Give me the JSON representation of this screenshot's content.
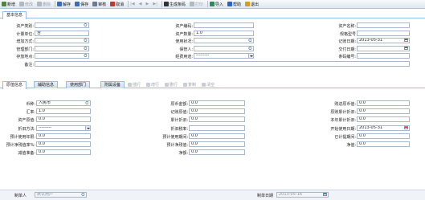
{
  "toolbar": {
    "buttons": [
      {
        "label": "新增",
        "enabled": true,
        "icon": "new-icon",
        "color": "#4b8a3b"
      },
      {
        "label": "修改",
        "enabled": false,
        "icon": "edit-icon",
        "color": "#b0b8c2"
      },
      {
        "label": "删除",
        "enabled": false,
        "icon": "delete-icon",
        "color": "#b0b8c2"
      },
      {
        "label": "解存",
        "enabled": true,
        "icon": "unsave-icon",
        "color": "#3a6db5"
      },
      {
        "label": "保存",
        "enabled": true,
        "icon": "save-icon",
        "color": "#3a6db5"
      },
      {
        "label": "审核",
        "enabled": true,
        "icon": "audit-icon",
        "color": "#6a7d94"
      },
      {
        "label": "取消",
        "enabled": true,
        "icon": "cancel-icon",
        "color": "#c0392b"
      },
      {
        "label": "生成条码",
        "enabled": true,
        "icon": "barcode-icon",
        "color": "#333333"
      },
      {
        "label": "打印",
        "enabled": false,
        "icon": "print-icon",
        "color": "#b0b8c2"
      },
      {
        "label": "导入",
        "enabled": true,
        "icon": "import-icon",
        "color": "#2e8b57"
      },
      {
        "label": "帮助",
        "enabled": true,
        "icon": "help-icon",
        "color": "#2a62c9"
      },
      {
        "label": "退出",
        "enabled": true,
        "icon": "exit-icon",
        "color": "#d4a017"
      }
    ],
    "nav_first": "|◀",
    "nav_prev": "◀",
    "nav_next": "▶",
    "nav_last": "▶|"
  },
  "basic_tab": {
    "label": "基本信息"
  },
  "basic_form": {
    "asset_category": {
      "label": "资产类别:",
      "value": ""
    },
    "asset_code": {
      "label": "资产编码:",
      "value": ""
    },
    "asset_name": {
      "label": "资产名称:",
      "value": ""
    },
    "unit": {
      "label": "计量单位:",
      "value": "台"
    },
    "quantity": {
      "label": "资产数量:",
      "value": "1.0"
    },
    "spec_model": {
      "label": "规格型号",
      "value": ""
    },
    "add_method": {
      "label": "增加方式:",
      "value": ""
    },
    "use_status": {
      "label": "使用状况:",
      "value": ""
    },
    "record_date": {
      "label": "记账日期:",
      "value": "2013-05-31"
    },
    "manage_dept": {
      "label": "管理部门:",
      "value": ""
    },
    "custodian": {
      "label": "保管人:",
      "value": ""
    },
    "delivery_date": {
      "label": "交付日期:",
      "value": ""
    },
    "storage_location": {
      "label": "存放地点:",
      "value": ""
    },
    "funding_source": {
      "label": "经费用途:",
      "value": "---------"
    },
    "barcode_no": {
      "label": "条码编号:",
      "value": ""
    },
    "remarks": {
      "label": "备注:",
      "value": ""
    }
  },
  "detail_tabs": [
    {
      "label": "原值信息",
      "active": true
    },
    {
      "label": "辅助信息",
      "active": false
    },
    {
      "label": "使用部门",
      "active": false
    },
    {
      "label": "附属设备",
      "active": false
    }
  ],
  "detail_toolbar": [
    "插行",
    "增行",
    "删行",
    "复制",
    "清空"
  ],
  "detail_form": {
    "currency": {
      "label": "币种:",
      "value": "人民币"
    },
    "original_value": {
      "label": "原币金额:",
      "value": "0.0"
    },
    "purchase_original": {
      "label": "购进原币值:",
      "value": "0.0"
    },
    "exchange_rate": {
      "label": "汇率:",
      "value": "1.0"
    },
    "record_value": {
      "label": "记账原值:",
      "value": "0.0"
    },
    "accum_depr": {
      "label": "原账累计折旧:",
      "value": "0.0"
    },
    "asset_original": {
      "label": "资产原值:",
      "value": "0.0"
    },
    "cum_depr": {
      "label": "累计折旧:",
      "value": "0.0"
    },
    "year_depr": {
      "label": "本年累计折旧:",
      "value": "0.0"
    },
    "depr_method": {
      "label": "折旧方法:",
      "value": "---------"
    },
    "depr_rate": {
      "label": "折旧税率:",
      "value": ""
    },
    "start_date": {
      "label": "开始使用日期:",
      "value": "2013-05-31"
    },
    "expected_years": {
      "label": "预计使用年限:",
      "value": "0.0"
    },
    "expected_period": {
      "label": "预计使用期间:",
      "value": "0.0"
    },
    "used_period": {
      "label": "已计提期间:",
      "value": "0.0"
    },
    "salvage_rate": {
      "label": "预计净残值率%:",
      "value": "0.0"
    },
    "salvage_value": {
      "label": "预计净残值:",
      "value": "0.0"
    },
    "net_value": {
      "label": "净值:",
      "value": "0.0"
    },
    "impairment": {
      "label": "减值准备:",
      "value": "0.0"
    },
    "net_amount": {
      "label": "净额:",
      "value": "0.0"
    }
  },
  "footer": {
    "maker_label": "制单人",
    "maker_placeholder": "默认用户",
    "make_date_label": "制单日期",
    "make_date_value": "2013-05-16"
  }
}
